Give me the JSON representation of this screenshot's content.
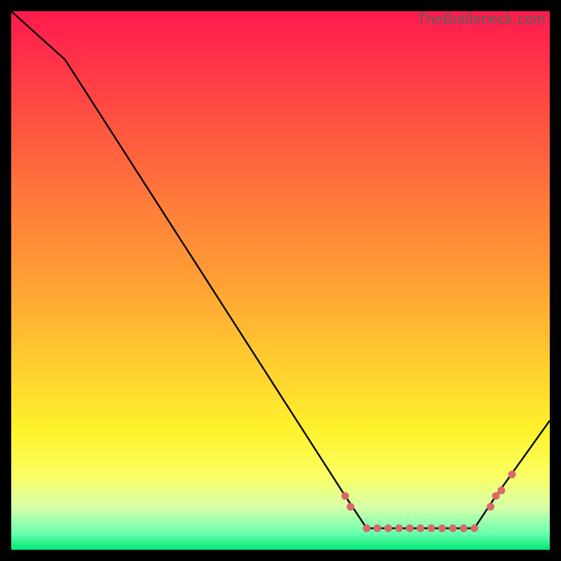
{
  "watermark": "TheBottleneck.com",
  "chart_data": {
    "type": "line",
    "title": "",
    "xlabel": "",
    "ylabel": "",
    "xlim": [
      0,
      100
    ],
    "ylim": [
      0,
      100
    ],
    "series": [
      {
        "name": "curve",
        "x": [
          0,
          10,
          62,
          66,
          86,
          90,
          100
        ],
        "y": [
          100,
          91,
          10,
          4,
          4,
          10,
          24
        ]
      }
    ],
    "markers": {
      "name": "dots",
      "x": [
        62,
        63,
        66,
        68,
        70,
        72,
        74,
        76,
        78,
        80,
        82,
        84,
        86,
        89,
        90,
        91,
        93
      ],
      "y": [
        10,
        8,
        4,
        4,
        4,
        4,
        4,
        4,
        4,
        4,
        4,
        4,
        4,
        8,
        10,
        11,
        14
      ]
    },
    "colors": {
      "line": "#000000",
      "markers": "#d96a6a"
    }
  }
}
